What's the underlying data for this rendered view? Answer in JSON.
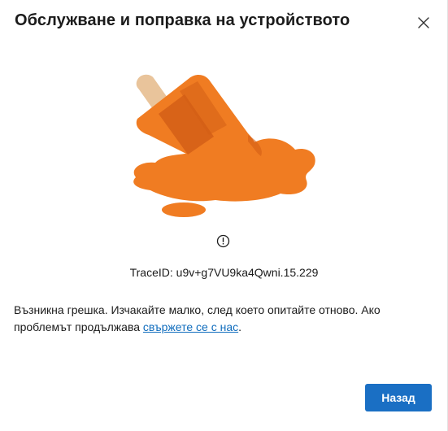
{
  "dialog": {
    "title": "Обслужване и поправка на устройството",
    "close_icon": "close-icon"
  },
  "illustration": {
    "name": "melted-popsicle-illustration",
    "colors": {
      "orange": "#f07c22",
      "orange_dark": "#d45f16",
      "stick": "#e9c49b"
    }
  },
  "error": {
    "icon": "info-icon",
    "trace_id": "TraceID: u9v+g7VU9ka4Qwni.15.229",
    "message_prefix": "Възникна грешка. Изчакайте малко, след което опитайте отново. Ако проблемът продължава ",
    "contact_link": "свържете се с нас",
    "message_suffix": "."
  },
  "footer": {
    "back_label": "Назад"
  },
  "colors": {
    "primary_button": "#1a6fc4",
    "link": "#0f6cbd",
    "text": "#1b1b1b"
  }
}
